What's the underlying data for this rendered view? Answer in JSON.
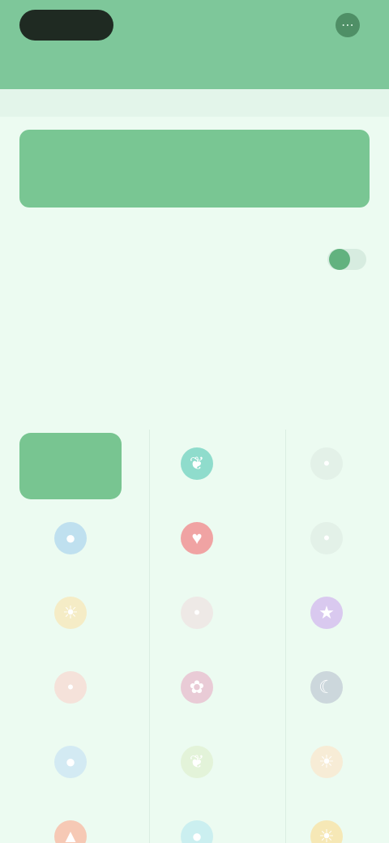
{
  "header": {
    "logo_text": "",
    "menu_icon": "more-icon",
    "subtitle": ""
  },
  "primary_button": {
    "label": ""
  },
  "options": {
    "row1_label": "",
    "row2_label": "",
    "row2_value": "",
    "row3_label": "",
    "row3_value": ""
  },
  "tiles": [
    {
      "label": "",
      "icon": "grid-icon",
      "color": "#78c591"
    },
    {
      "label": "",
      "icon": "leaf-icon",
      "color": "#8fdccc"
    },
    {
      "label": "",
      "icon": "dot-icon",
      "color": "#e3f1e8"
    },
    {
      "label": "",
      "icon": "drop-icon",
      "color": "#bfe0ef"
    },
    {
      "label": "",
      "icon": "heart-icon",
      "color": "#f0a3a3"
    },
    {
      "label": "",
      "icon": "dot-icon",
      "color": "#e3f1e8"
    },
    {
      "label": "",
      "icon": "sun-icon",
      "color": "#f5ecc6"
    },
    {
      "label": "",
      "icon": "dot-icon",
      "color": "#eee9e6"
    },
    {
      "label": "",
      "icon": "star-icon",
      "color": "#d9c9ef"
    },
    {
      "label": "",
      "icon": "dot-icon",
      "color": "#f5e2da"
    },
    {
      "label": "",
      "icon": "flower-icon",
      "color": "#e9cbd6"
    },
    {
      "label": "",
      "icon": "moon-icon",
      "color": "#ccd7dc"
    },
    {
      "label": "",
      "icon": "drop-icon",
      "color": "#d3eaf3"
    },
    {
      "label": "",
      "icon": "leaf-icon",
      "color": "#e3f3d9"
    },
    {
      "label": "",
      "icon": "sun-icon",
      "color": "#f7ecd6"
    },
    {
      "label": "",
      "icon": "fire-icon",
      "color": "#f6c9b5"
    },
    {
      "label": "",
      "icon": "drop-icon",
      "color": "#cbeff0"
    },
    {
      "label": "",
      "icon": "sun-icon",
      "color": "#f6e8b6"
    }
  ],
  "colors": {
    "header": "#7ec79a",
    "accent": "#79c693",
    "background": "#ecfbf1"
  }
}
